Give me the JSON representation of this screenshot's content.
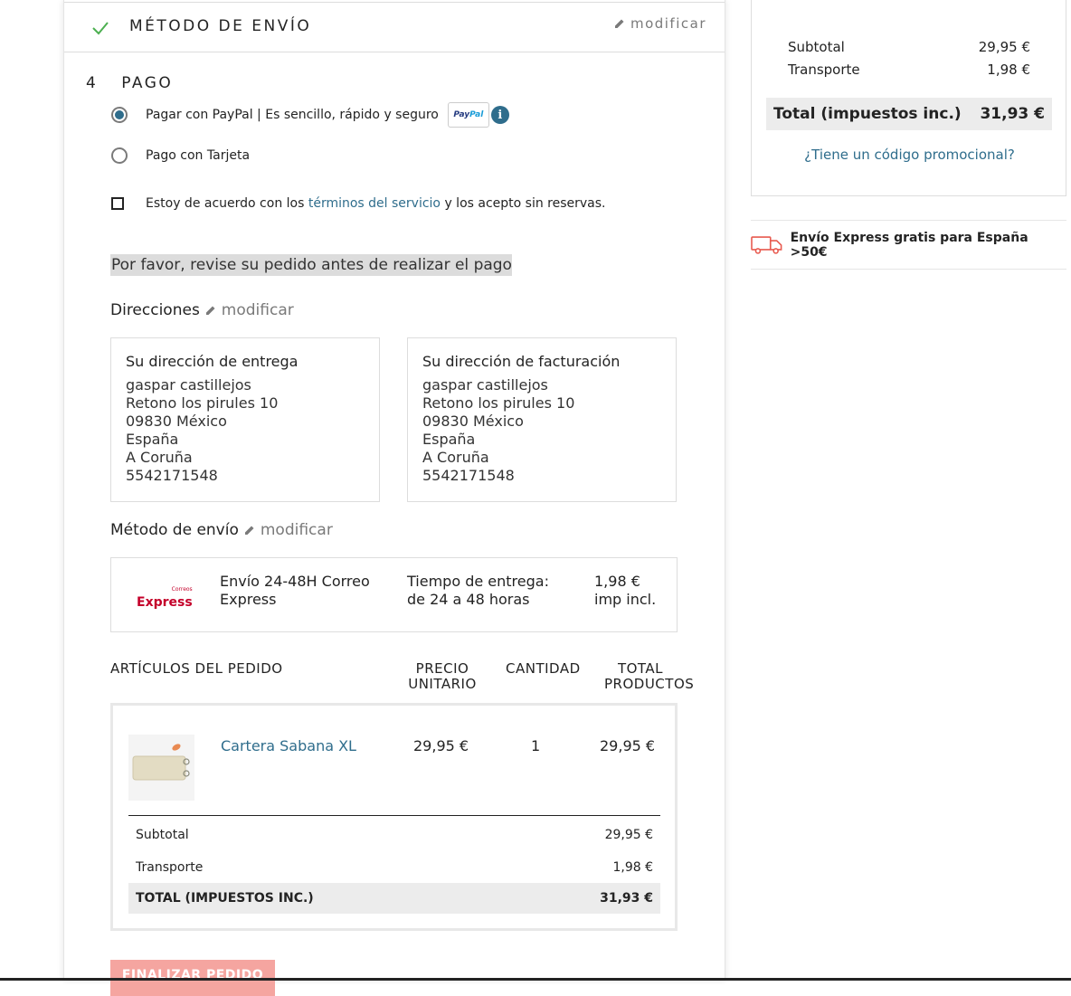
{
  "shipping_step": {
    "title": "MÉTODO DE ENVÍO",
    "edit_label": "modificar"
  },
  "payment_step": {
    "number": "4",
    "title": "PAGO",
    "options": [
      {
        "label": "Pagar con PayPal | Es sencillo, rápido y seguro",
        "selected": true,
        "badge": "PayPal"
      },
      {
        "label": "Pago con Tarjeta",
        "selected": false
      }
    ],
    "terms": {
      "before": "Estoy de acuerdo con los ",
      "link": "términos del servicio",
      "after": " y los acepto sin reservas.",
      "checked": false
    }
  },
  "review_notice": "Por favor, revise su pedido antes de realizar el pago",
  "addresses": {
    "heading": "Direcciones",
    "edit_label": "modificar",
    "delivery": {
      "title": "Su dirección de entrega",
      "lines": [
        "gaspar castillejos",
        "Retono los pirules 10",
        "09830 México",
        "España",
        "A Coruña",
        "5542171548"
      ]
    },
    "billing": {
      "title": "Su dirección de facturación",
      "lines": [
        "gaspar castillejos",
        "Retono los pirules 10",
        "09830 México",
        "España",
        "A Coruña",
        "5542171548"
      ]
    }
  },
  "shipping_method": {
    "heading": "Método de envío",
    "edit_label": "modificar",
    "carrier_logo_small": "Correos",
    "carrier_logo_big": "Express",
    "name": "Envío 24-48H Correo Express",
    "delivery_time": "Tiempo de entrega: de 24 a 48 horas",
    "price": "1,98 € imp incl."
  },
  "order_items": {
    "headers": {
      "items": "ARTÍCULOS DEL PEDIDO",
      "unit_price": "PRECIO UNITARIO",
      "quantity": "CANTIDAD",
      "total": "TOTAL PRODUCTOS"
    },
    "products": [
      {
        "name": "Cartera Sabana XL",
        "unit_price": "29,95 €",
        "quantity": "1",
        "total": "29,95 €"
      }
    ],
    "subtotal_label": "Subtotal",
    "subtotal": "29,95 €",
    "shipping_label": "Transporte",
    "shipping": "1,98 €",
    "total_label": "TOTAL (IMPUESTOS INC.)",
    "total": "31,93 €"
  },
  "finalize_button": "FINALIZAR PEDIDO",
  "cart_summary": {
    "subtotal_label": "Subtotal",
    "subtotal": "29,95 €",
    "shipping_label": "Transporte",
    "shipping": "1,98 €",
    "total_label": "Total (impuestos inc.)",
    "total": "31,93 €",
    "promo_link": "¿Tiene un código promocional?"
  },
  "free_shipping_banner": "Envío Express gratis para España >50€",
  "colors": {
    "accent": "#2f6d8c",
    "button": "#f5a5a0",
    "check": "#4caf50",
    "truck": "#e85a4f"
  },
  "icons": [
    "check-icon",
    "pencil-icon",
    "info-icon",
    "truck-icon"
  ]
}
